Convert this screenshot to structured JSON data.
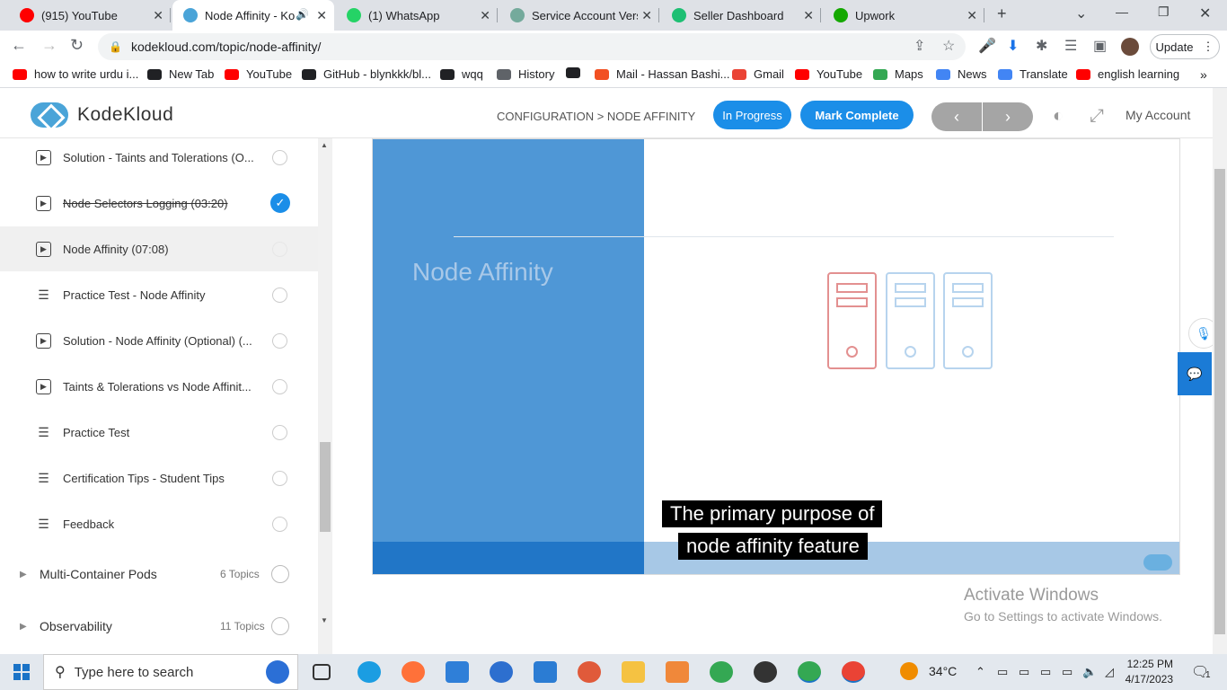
{
  "browser": {
    "tabs": [
      {
        "title": "(915) YouTube",
        "icon": "youtube-icon",
        "color": "#ff0000",
        "active": false
      },
      {
        "title": "Node Affinity - Ko",
        "icon": "kodekloud-icon",
        "color": "#4aa4d8",
        "active": true
      },
      {
        "title": "(1) WhatsApp",
        "icon": "whatsapp-icon",
        "color": "#25d366",
        "active": false
      },
      {
        "title": "Service Account Versio",
        "icon": "chatgpt-icon",
        "color": "#74aa9c",
        "active": false
      },
      {
        "title": "Seller Dashboard",
        "icon": "fiverr-icon",
        "color": "#1dbf73",
        "active": false
      },
      {
        "title": "Upwork",
        "icon": "upwork-icon",
        "color": "#14a800",
        "active": false
      }
    ],
    "url": "kodekloud.com/topic/node-affinity/",
    "update_label": "Update",
    "bookmarks": [
      {
        "label": "how to write urdu i...",
        "icon": "youtube-icon",
        "color": "#ff0000"
      },
      {
        "label": "New Tab",
        "icon": "globe-icon",
        "color": "#202124"
      },
      {
        "label": "YouTube",
        "icon": "youtube-icon",
        "color": "#ff0000"
      },
      {
        "label": "GitHub - blynkkk/bl...",
        "icon": "github-icon",
        "color": "#202124"
      },
      {
        "label": "wqq",
        "icon": "download-icon",
        "color": "#202124"
      },
      {
        "label": "History",
        "icon": "history-icon",
        "color": "#5f6368"
      },
      {
        "label": "",
        "icon": "globe-icon",
        "color": "#202124"
      },
      {
        "label": "Mail - Hassan Bashi...",
        "icon": "microsoft-icon",
        "color": "#f25022"
      },
      {
        "label": "Gmail",
        "icon": "gmail-icon",
        "color": "#ea4335"
      },
      {
        "label": "YouTube",
        "icon": "youtube-icon",
        "color": "#ff0000"
      },
      {
        "label": "Maps",
        "icon": "maps-icon",
        "color": "#34a853"
      },
      {
        "label": "News",
        "icon": "news-icon",
        "color": "#4285f4"
      },
      {
        "label": "Translate",
        "icon": "translate-icon",
        "color": "#4285f4"
      },
      {
        "label": "english learning",
        "icon": "youtube-icon",
        "color": "#ff0000"
      }
    ]
  },
  "header": {
    "logo_text": "KodeKloud",
    "breadcrumb": "CONFIGURATION > NODE AFFINITY",
    "status_label": "In Progress",
    "complete_label": "Mark Complete",
    "prev_label": "‹",
    "next_label": "›",
    "account_label": "My Account"
  },
  "sidebar": {
    "lessons": [
      {
        "title": "Solution - Taints and Tolerations (O...",
        "type": "video",
        "state": "todo"
      },
      {
        "title": "Node Selectors Logging (03:20)",
        "type": "video",
        "state": "done"
      },
      {
        "title": "Node Affinity (07:08)",
        "type": "video",
        "state": "current"
      },
      {
        "title": "Practice Test - Node Affinity",
        "type": "list",
        "state": "todo"
      },
      {
        "title": "Solution - Node Affinity (Optional) (...",
        "type": "video",
        "state": "todo"
      },
      {
        "title": "Taints & Tolerations vs Node Affinit...",
        "type": "video",
        "state": "todo"
      },
      {
        "title": "Practice Test",
        "type": "list",
        "state": "todo"
      },
      {
        "title": "Certification Tips - Student Tips",
        "type": "list",
        "state": "todo"
      },
      {
        "title": "Feedback",
        "type": "list",
        "state": "todo"
      }
    ],
    "sections": [
      {
        "title": "Multi-Container Pods",
        "count": "6 Topics"
      },
      {
        "title": "Observability",
        "count": "11 Topics"
      }
    ]
  },
  "video": {
    "slide_title": "Node Affinity",
    "caption_line1": "The primary purpose of",
    "caption_line2": "node affinity feature"
  },
  "watermark": {
    "line1": "Activate Windows",
    "line2": "Go to Settings to activate Windows."
  },
  "taskbar": {
    "search_placeholder": "Type here to search",
    "temperature": "34°C",
    "time": "12:25 PM",
    "date": "4/17/2023",
    "notification_count": "1"
  }
}
